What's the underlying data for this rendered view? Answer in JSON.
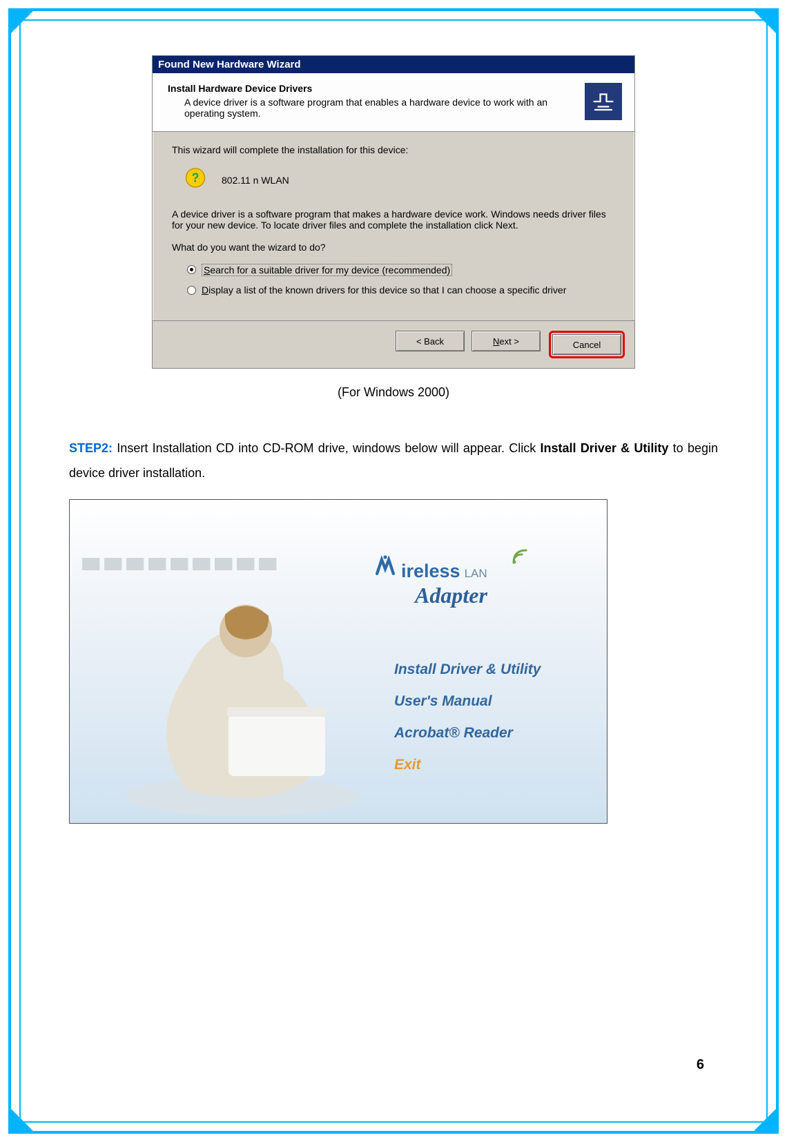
{
  "dialog": {
    "title": "Found New Hardware Wizard",
    "heading": "Install Hardware Device Drivers",
    "sub": "A device driver is a software program that enables a hardware device to work with an operating system.",
    "intro": "This wizard will complete the installation for this device:",
    "device": "802.11 n WLAN",
    "explain": "A device driver is a software program that makes a hardware device work. Windows needs driver files for your new device. To locate driver files and complete the installation click Next.",
    "question": "What do you want the wizard to do?",
    "opt1": "Search for a suitable driver for my device (recommended)",
    "opt2": "Display a list of the known drivers for this device so that I can choose a specific driver",
    "back": "< Back",
    "next": "Next >",
    "cancel": "Cancel"
  },
  "caption": "(For Windows 2000)",
  "step": {
    "label": "STEP2:",
    "t1": " Insert Installation CD into CD-ROM drive, windows below will appear. Click ",
    "action": "Install Driver & Utility",
    "t2": " to begin device driver installation."
  },
  "autorun": {
    "brand1": "ireless",
    "brand2": "LAN",
    "adapter": "Adapter",
    "menu": {
      "install": "Install Driver & Utility",
      "manual": "User's  Manual",
      "acrobat": "Acrobat® Reader",
      "exit": "Exit"
    }
  },
  "page_number": "6"
}
